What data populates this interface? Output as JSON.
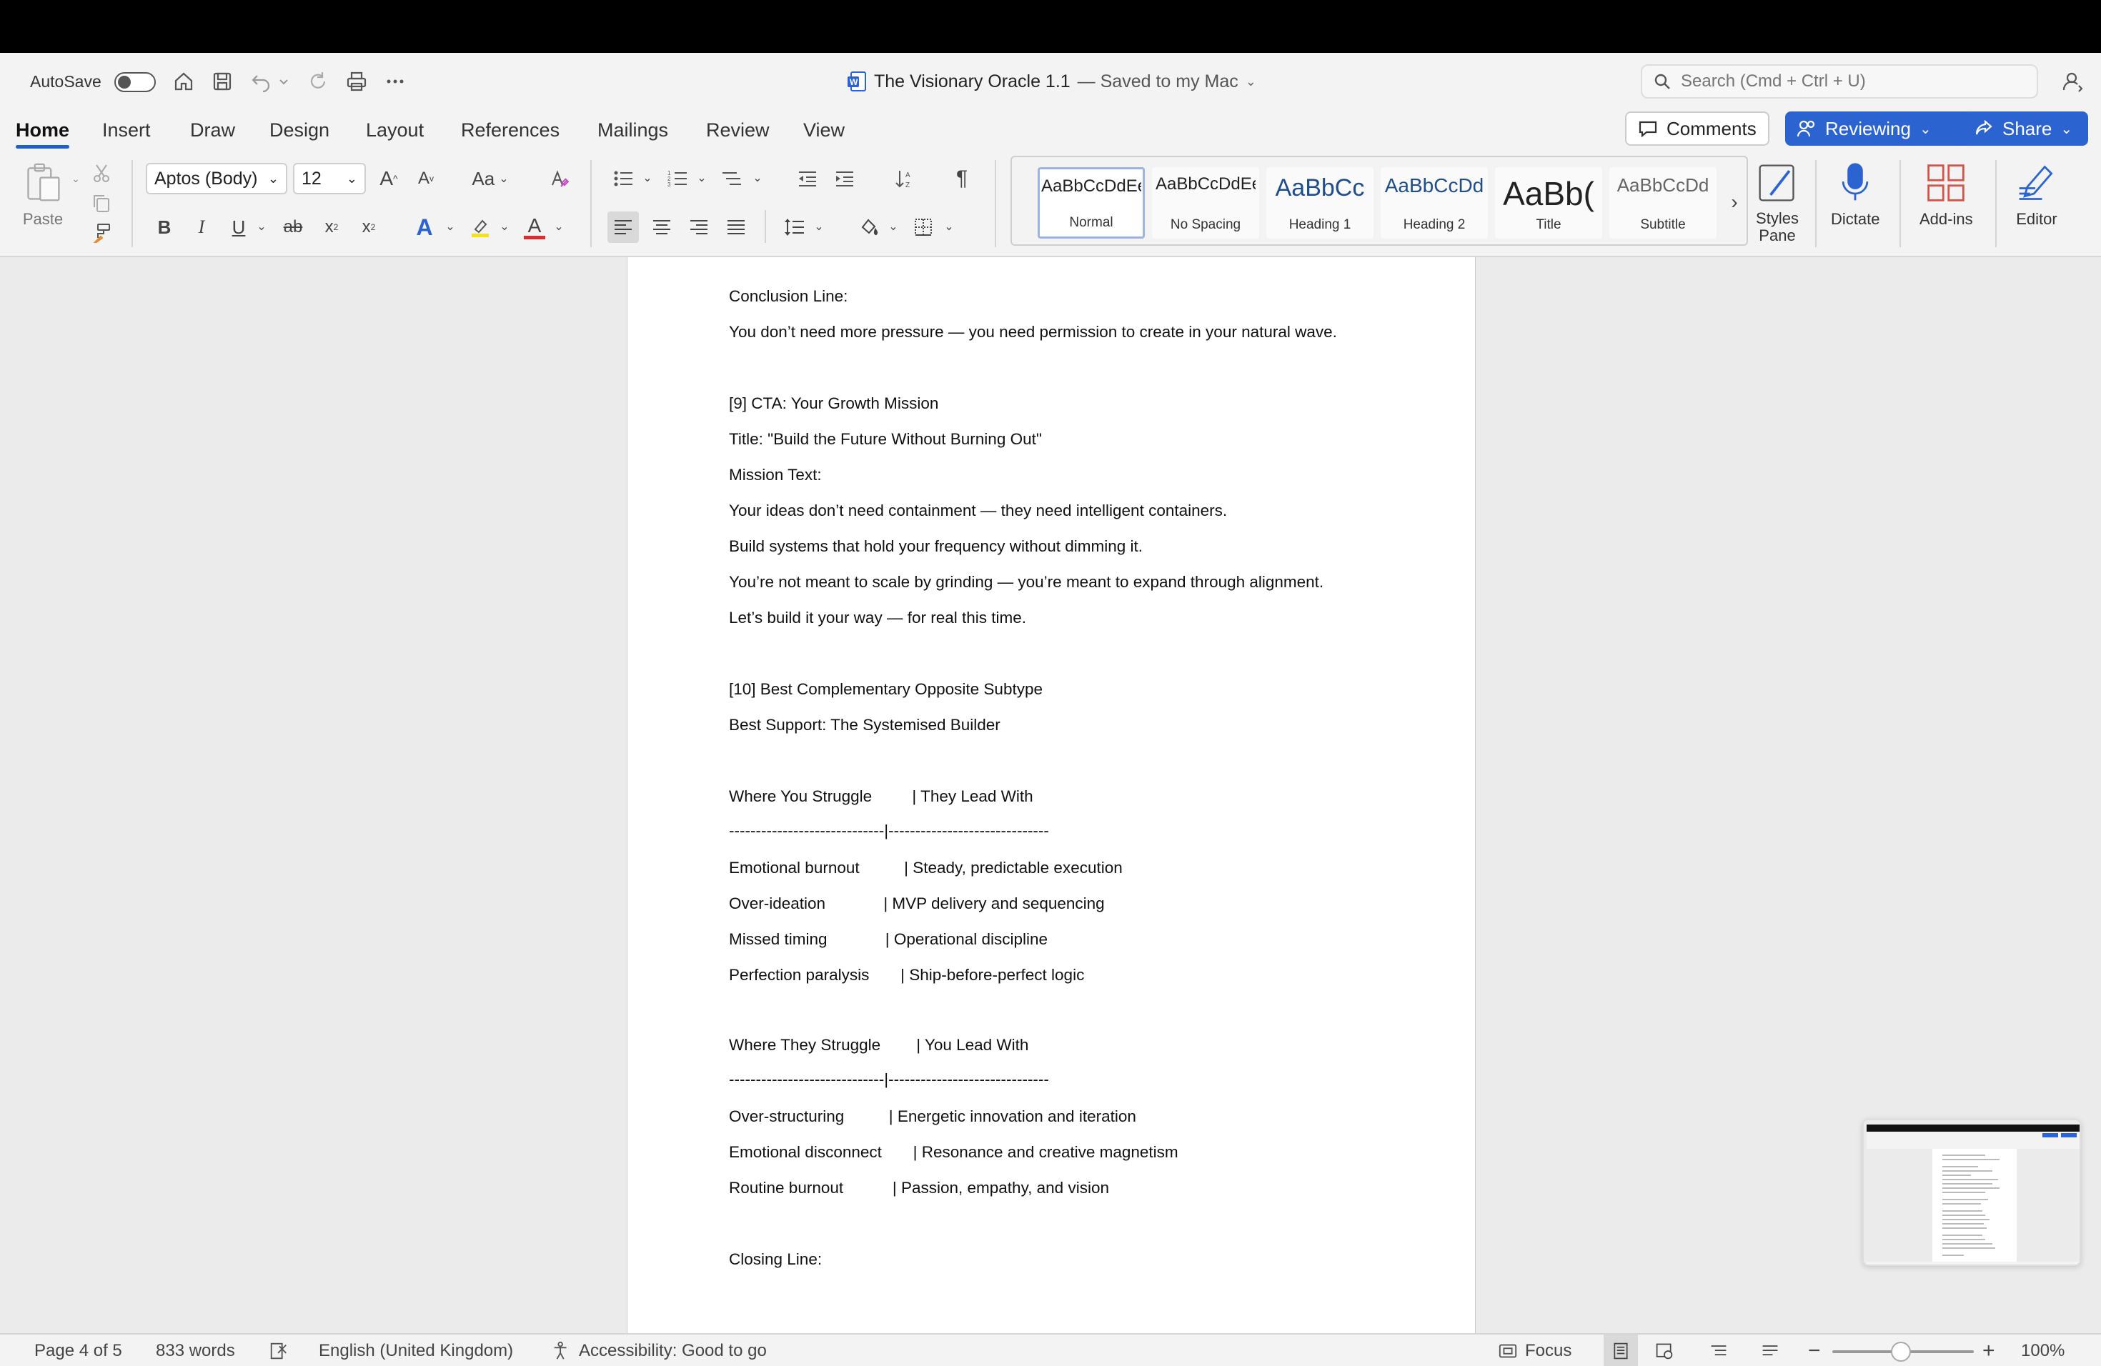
{
  "titlebar": {
    "autosave_label": "AutoSave",
    "doc_name": "The Visionary Oracle  1.1",
    "saved_status": "— Saved to my Mac",
    "search_placeholder": "Search (Cmd + Ctrl + U)"
  },
  "tabs": [
    "Home",
    "Insert",
    "Draw",
    "Design",
    "Layout",
    "References",
    "Mailings",
    "Review",
    "View"
  ],
  "header_buttons": {
    "comments": "Comments",
    "reviewing": "Reviewing",
    "share": "Share"
  },
  "ribbon": {
    "paste_label": "Paste",
    "font_name": "Aptos (Body)",
    "font_size": "12",
    "change_case": "Aa",
    "styles": [
      {
        "sample": "AaBbCcDdEe",
        "name": "Normal"
      },
      {
        "sample": "AaBbCcDdEe",
        "name": "No Spacing"
      },
      {
        "sample": "AaBbCc",
        "name": "Heading 1"
      },
      {
        "sample": "AaBbCcDd",
        "name": "Heading 2"
      },
      {
        "sample": "AaBb(",
        "name": "Title"
      },
      {
        "sample": "AaBbCcDd",
        "name": "Subtitle"
      }
    ],
    "styles_pane": "Styles Pane",
    "dictate": "Dictate",
    "addins": "Add-ins",
    "editor": "Editor"
  },
  "document": {
    "lines": [
      "Conclusion Line:",
      "You don’t need more pressure — you need permission to create in your natural wave.",
      "",
      "[9] CTA: Your Growth Mission",
      "Title: \"Build the Future Without Burning Out\"",
      "Mission Text:",
      "Your ideas don’t need containment — they need intelligent containers.",
      "Build systems that hold your frequency without dimming it.",
      "You’re not meant to scale by grinding — you’re meant to expand through alignment.",
      "Let’s build it your way — for real this time.",
      "",
      "[10] Best Complementary Opposite Subtype",
      "Best Support: The Systemised Builder",
      "",
      "Where You Struggle         | They Lead With",
      "-----------------------------|------------------------------",
      "Emotional burnout          | Steady, predictable execution",
      "Over-ideation             | MVP delivery and sequencing",
      "Missed timing             | Operational discipline",
      "Perfection paralysis       | Ship-before-perfect logic",
      "",
      "Where They Struggle        | You Lead With",
      "-----------------------------|------------------------------",
      "Over-structuring          | Energetic innovation and iteration",
      "Emotional disconnect       | Resonance and creative magnetism",
      "Routine burnout           | Passion, empathy, and vision",
      "",
      "Closing Line:"
    ]
  },
  "statusbar": {
    "page": "Page 4 of 5",
    "words": "833 words",
    "language": "English (United Kingdom)",
    "accessibility": "Accessibility: Good to go",
    "focus": "Focus",
    "zoom": "100%"
  },
  "colors": {
    "accent": "#2b63d1",
    "highlight": "#f5e11a",
    "font_color": "#d32f2f",
    "ribbon_bg": "#f3f3f3",
    "canvas_bg": "#ebebeb"
  }
}
